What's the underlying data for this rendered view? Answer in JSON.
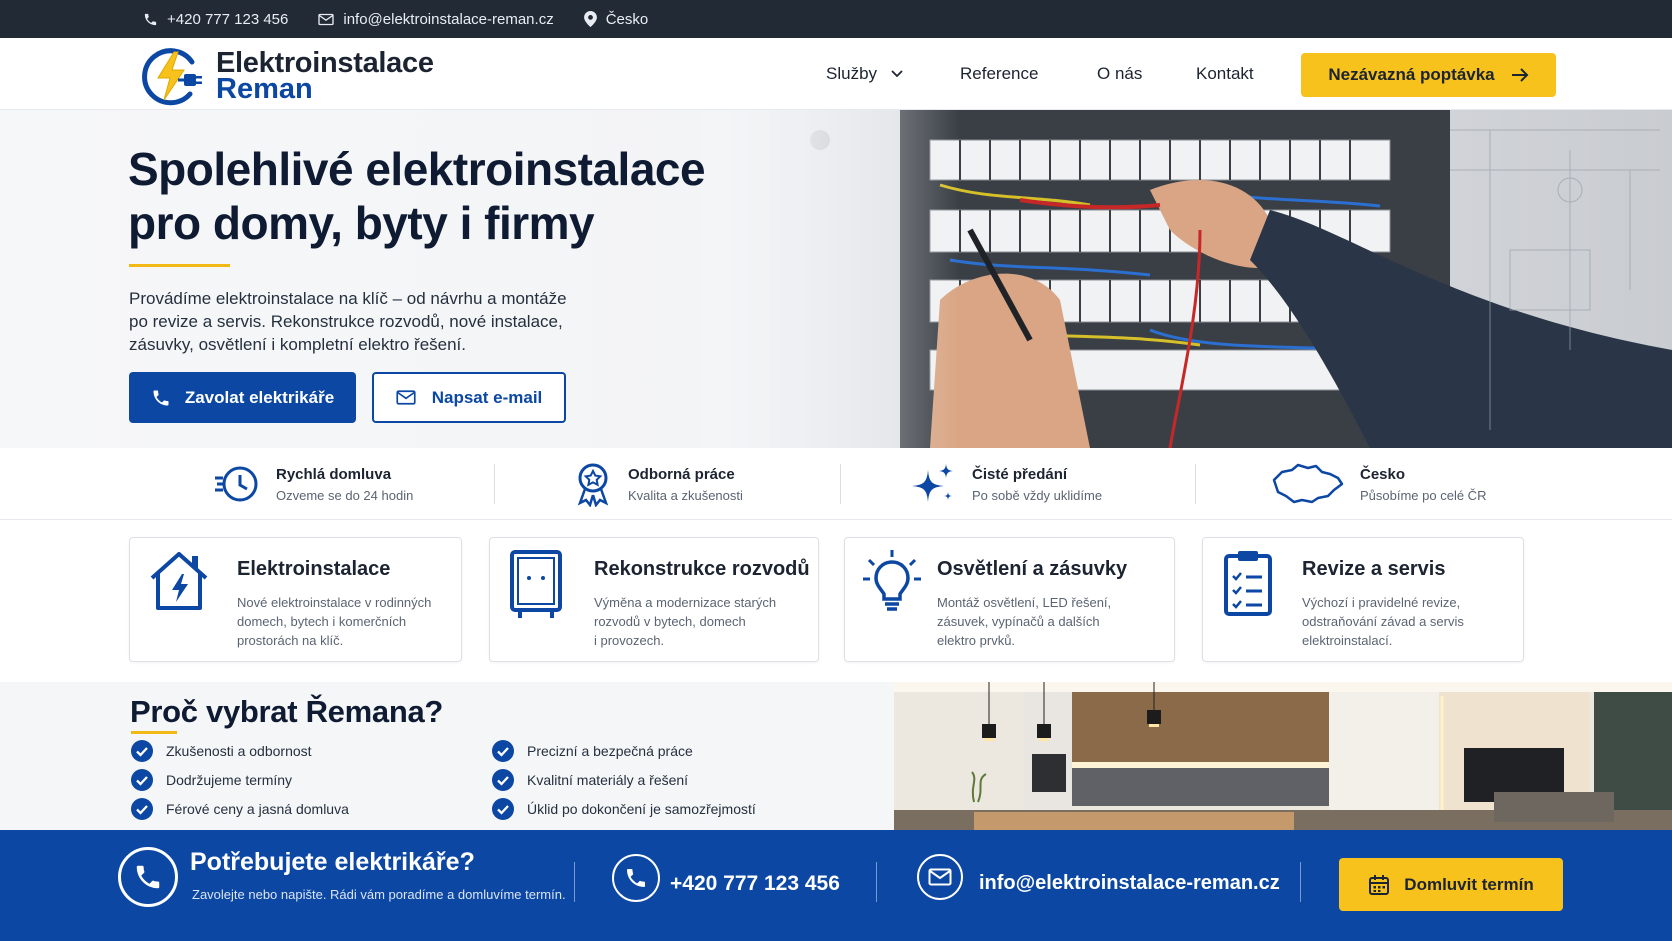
{
  "topbar": {
    "phone": "+420 777 123 456",
    "email": "info@elektroinstalace-reman.cz",
    "location": "Česko"
  },
  "header": {
    "logo_line1": "Elektroinstalace",
    "logo_line2": "Reman",
    "nav": [
      {
        "label": "Služby"
      },
      {
        "label": "Reference"
      },
      {
        "label": "O nás"
      },
      {
        "label": "Kontakt"
      }
    ],
    "cta": "Nezávazná poptávka"
  },
  "hero": {
    "title_line1": "Spolehlivé elektroinstalace",
    "title_line2": "pro domy, byty i firmy",
    "text": "Provádíme elektroinstalace na klíč – od návrhu a montáže po revize a servis. Rekonstrukce rozvodů, nové instalace, zásuvky, osvětlení i kompletní elektro řešení.",
    "btn_call": "Zavolat elektrikáře",
    "btn_mail": "Napsat e-mail"
  },
  "features": [
    {
      "title": "Rychlá domluva",
      "sub": "Ozveme se do 24 hodin"
    },
    {
      "title": "Odborná práce",
      "sub": "Kvalita a zkušenosti"
    },
    {
      "title": "Čisté předání",
      "sub": "Po sobě vždy uklidíme"
    },
    {
      "title": "Česko",
      "sub": "Působíme po celé ČR"
    }
  ],
  "services": [
    {
      "title": "Elektroinstalace",
      "desc": [
        "Nové elektroinstalace v rodinných",
        "domech, bytech i komerčních",
        "prostorách na klíč."
      ]
    },
    {
      "title": "Rekonstrukce rozvodů",
      "desc": [
        "Výměna a modernizace starých",
        "rozvodů v bytech, domech",
        "i provozech."
      ]
    },
    {
      "title": "Osvětlení a zásuvky",
      "desc": [
        "Montáž osvětlení, LED řešení,",
        "zásuvek, vypínačů a dalších",
        "elektro prvků."
      ]
    },
    {
      "title": "Revize a servis",
      "desc": [
        "Výchozí i pravidelné revize,",
        "odstraňování závad a servis",
        "elektroinstalací."
      ]
    }
  ],
  "why": {
    "title": "Proč vybrat Řemana?",
    "items": [
      "Zkušenosti a odbornost",
      "Dodržujeme termíny",
      "Férové ceny a jasná domluva",
      "Precizní a bezpečná práce",
      "Kvalitní materiály a řešení",
      "Úklid po dokončení je samozřejmostí"
    ]
  },
  "band": {
    "title": "Potřebujete elektrikáře?",
    "subtitle": "Zavolejte nebo napište. Rádi vám poradíme a domluvíme termín.",
    "phone": "+420 777 123 456",
    "email": "info@elektroinstalace-reman.cz",
    "cta": "Domluvit termín"
  },
  "colors": {
    "brand_blue": "#0b47a3",
    "accent_yellow": "#f7c21b",
    "topbar_dark": "#222a36"
  },
  "icons": [
    "phone-icon",
    "mail-icon",
    "pin-icon",
    "chevron-down-icon",
    "arrow-right-icon",
    "clock-icon",
    "award-icon",
    "sparkle-icon",
    "czech-map-icon",
    "house-bolt-icon",
    "distribution-box-icon",
    "lightbulb-icon",
    "clipboard-check-icon",
    "check-circle-icon",
    "calendar-icon"
  ]
}
